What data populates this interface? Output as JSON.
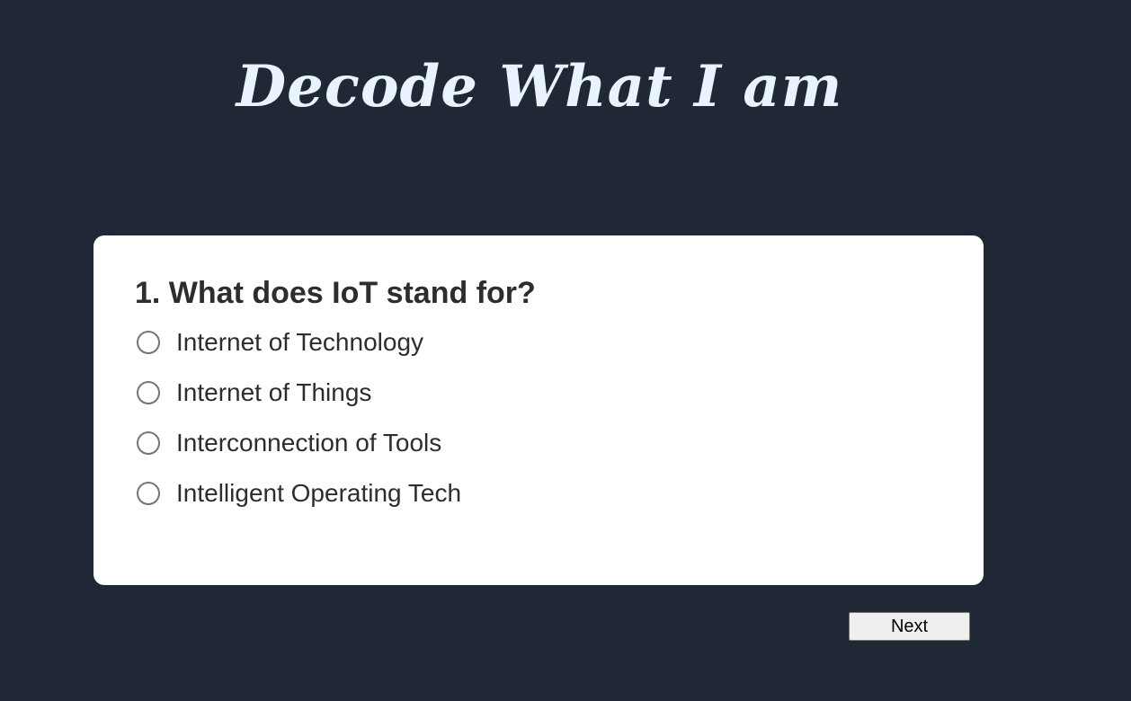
{
  "header": {
    "title": "Decode What I am"
  },
  "quiz": {
    "question": "1. What does IoT stand for?",
    "options": [
      {
        "label": "Internet of Technology",
        "selected": false
      },
      {
        "label": "Internet of Things",
        "selected": false
      },
      {
        "label": "Interconnection of Tools",
        "selected": false
      },
      {
        "label": "Intelligent Operating Tech",
        "selected": false
      }
    ]
  },
  "controls": {
    "next_label": "Next"
  },
  "colors": {
    "background": "#212835",
    "title": "#e9f3ff",
    "card": "#ffffff",
    "text": "#2d2d2d",
    "radio_border": "#767676",
    "button_bg": "#efefef"
  }
}
